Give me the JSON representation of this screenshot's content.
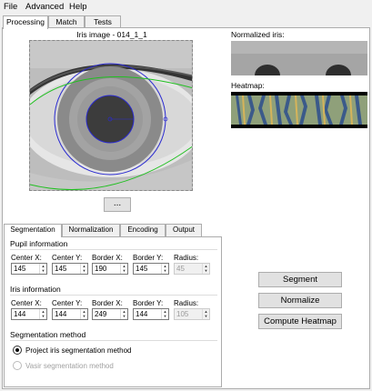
{
  "menu": [
    "File",
    "Advanced",
    "Help"
  ],
  "tabs": [
    "Processing",
    "Match",
    "Tests"
  ],
  "iris_title": "Iris image - 014_1_1",
  "browse_button": "...",
  "normalized_label": "Normalized iris:",
  "heatmap_label": "Heatmap:",
  "sub_tabs": [
    "Segmentation",
    "Normalization",
    "Encoding",
    "Output"
  ],
  "pupil": {
    "title": "Pupil information",
    "labels": [
      "Center X:",
      "Center Y:",
      "Border X:",
      "Border Y:",
      "Radius:"
    ],
    "values": [
      "145",
      "145",
      "190",
      "145",
      "45"
    ]
  },
  "iris": {
    "title": "Iris information",
    "labels": [
      "Center X:",
      "Center Y:",
      "Border X:",
      "Border Y:",
      "Radius:"
    ],
    "values": [
      "144",
      "144",
      "249",
      "144",
      "105"
    ]
  },
  "method": {
    "title": "Segmentation method",
    "options": [
      "Project iris segmentation method",
      "Vasir segmentation method"
    ],
    "selected": 0
  },
  "buttons": [
    "Segment",
    "Normalize",
    "Compute Heatmap"
  ]
}
